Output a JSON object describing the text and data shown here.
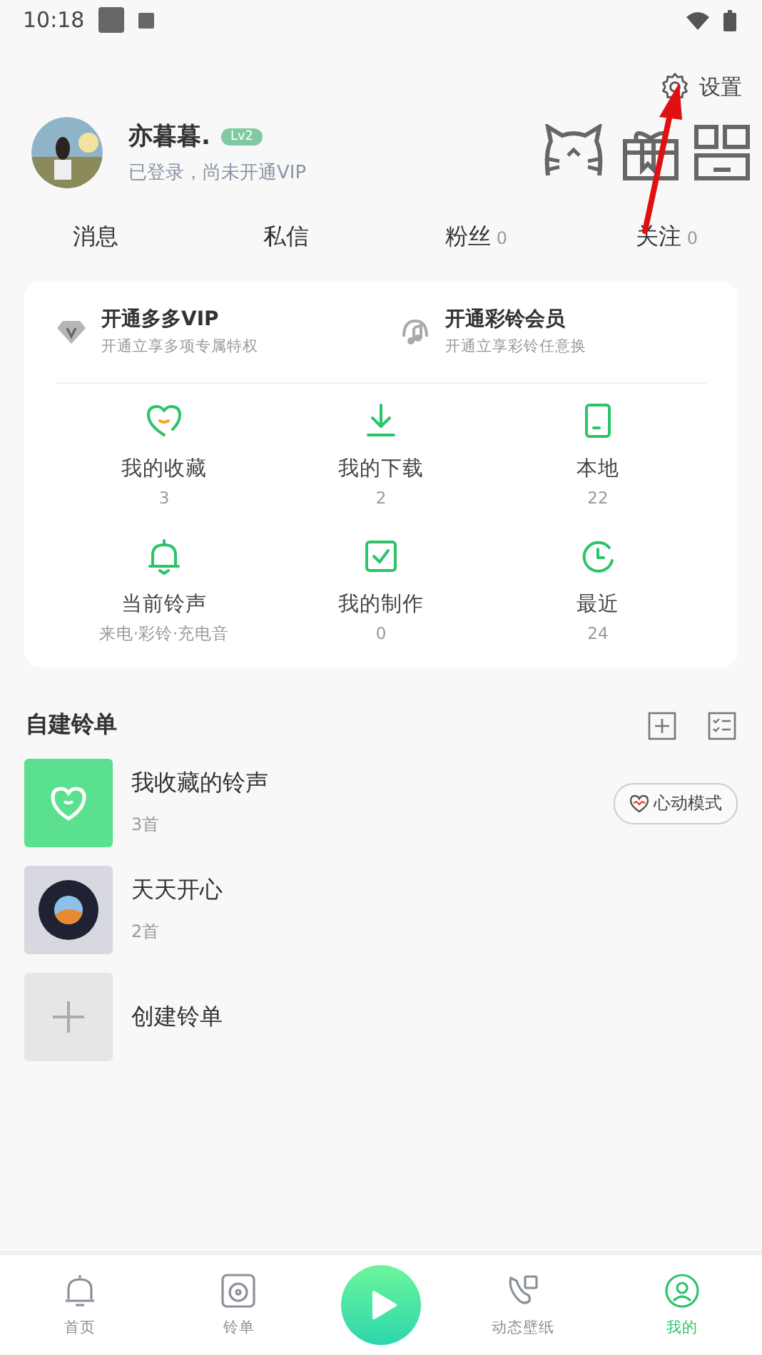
{
  "status_bar": {
    "time": "10:18"
  },
  "settings": {
    "label": "设置"
  },
  "profile": {
    "name": "亦暮暮.",
    "level": "Lv2",
    "status": "已登录，尚未开通VIP"
  },
  "social": [
    {
      "label": "消息"
    },
    {
      "label": "私信"
    },
    {
      "label": "粉丝",
      "count": "0"
    },
    {
      "label": "关注",
      "count": "0"
    }
  ],
  "promos": [
    {
      "kind": "vip",
      "title": "开通多多VIP",
      "subtitle": "开通立享多项专属特权"
    },
    {
      "kind": "ringtone",
      "title": "开通彩铃会员",
      "subtitle": "开通立享彩铃任意换"
    }
  ],
  "shortcuts": [
    {
      "kind": "heart",
      "label": "我的收藏",
      "value": "3"
    },
    {
      "kind": "download",
      "label": "我的下载",
      "value": "2"
    },
    {
      "kind": "phone",
      "label": "本地",
      "value": "22"
    },
    {
      "kind": "bell",
      "label": "当前铃声",
      "value": "来电·彩铃·充电音"
    },
    {
      "kind": "check",
      "label": "我的制作",
      "value": "0"
    },
    {
      "kind": "clock",
      "label": "最近",
      "value": "24"
    }
  ],
  "playlists": {
    "title": "自建铃单",
    "items": [
      {
        "kind": "favorites",
        "name": "我收藏的铃声",
        "count": "3首",
        "badge": "心动模式"
      },
      {
        "kind": "cover",
        "name": "天天开心",
        "count": "2首"
      },
      {
        "kind": "create",
        "name": "创建铃单"
      }
    ]
  },
  "bottom_nav": [
    {
      "kind": "bell",
      "label": "首页",
      "selected": false
    },
    {
      "kind": "disc",
      "label": "铃单",
      "selected": false
    },
    {
      "kind": "play",
      "selected": false
    },
    {
      "kind": "wallpaper",
      "label": "动态壁纸",
      "selected": false
    },
    {
      "kind": "me",
      "label": "我的",
      "selected": true
    }
  ]
}
